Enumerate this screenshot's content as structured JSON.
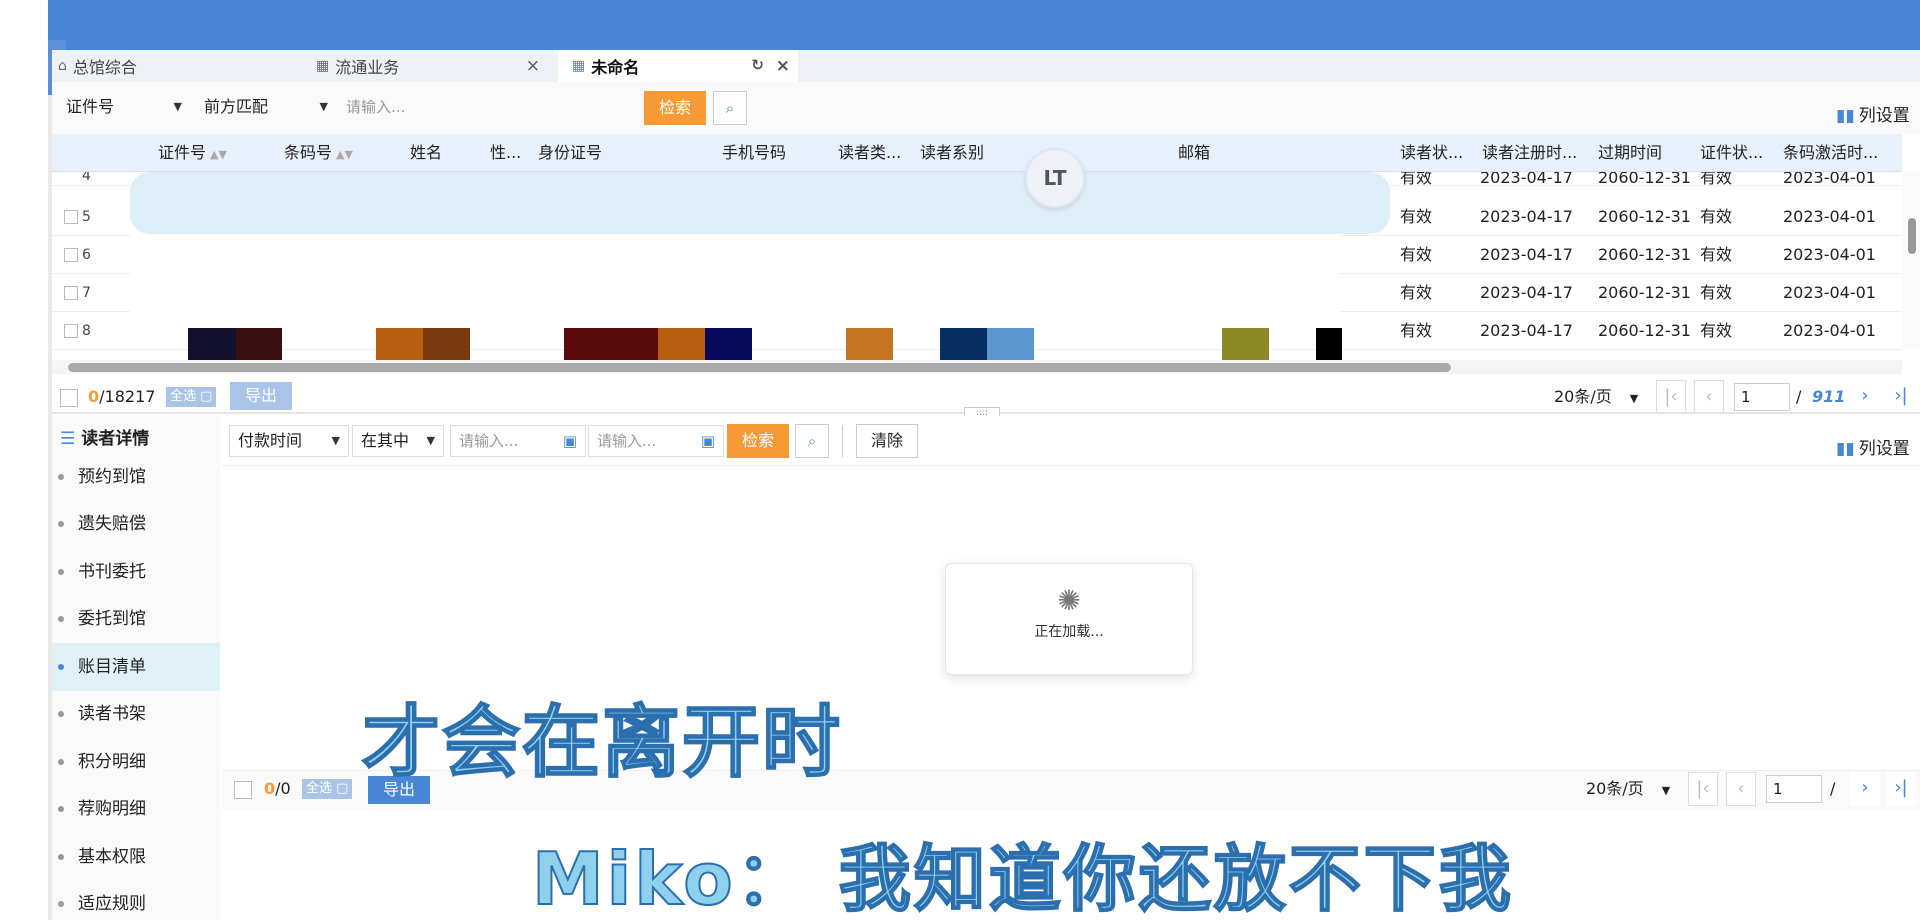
{
  "tabs": [
    {
      "label": "总馆综合",
      "icon": "home-icon"
    },
    {
      "label": "流通业务",
      "icon": "grid-icon"
    },
    {
      "label": "未命名",
      "icon": "grid-icon"
    }
  ],
  "toolbar1": {
    "field_select": "证件号",
    "match_select": "前方匹配",
    "search_placeholder": "请输入...",
    "search_label": "检索",
    "column_settings": "列设置"
  },
  "table": {
    "columns": [
      "证件号",
      "条码号",
      "姓名",
      "性...",
      "身份证号",
      "手机号码",
      "读者类...",
      "读者系别",
      "邮箱",
      "读者状...",
      "读者注册时...",
      "过期时间",
      "证件状...",
      "条码激活时..."
    ],
    "rows": [
      {
        "index": "4",
        "status": "有效",
        "reg": "2023-04-17",
        "expire": "2060-12-31",
        "cert": "有效",
        "activate": "2023-04-01"
      },
      {
        "index": "5",
        "status": "有效",
        "reg": "2023-04-17",
        "expire": "2060-12-31",
        "cert": "有效",
        "activate": "2023-04-01"
      },
      {
        "index": "6",
        "status": "有效",
        "reg": "2023-04-17",
        "expire": "2060-12-31",
        "cert": "有效",
        "activate": "2023-04-01"
      },
      {
        "index": "7",
        "status": "有效",
        "reg": "2023-04-17",
        "expire": "2060-12-31",
        "cert": "有效",
        "activate": "2023-04-01"
      },
      {
        "index": "8",
        "status": "有效",
        "reg": "2023-04-17",
        "expire": "2060-12-31",
        "cert": "有效",
        "activate": "2023-04-01"
      }
    ],
    "avatar_text": "LT"
  },
  "pager1": {
    "selected": "0",
    "total": "/18217",
    "select_all": "全选",
    "export": "导出",
    "page_size": "20条/页",
    "page": "1",
    "sep": "/",
    "total_pages": "911"
  },
  "sidebar": {
    "title": "读者详情",
    "items": [
      "预约到馆",
      "遗失赔偿",
      "书刊委托",
      "委托到馆",
      "账目清单",
      "读者书架",
      "积分明细",
      "荐购明细",
      "基本权限",
      "适应规则"
    ],
    "active_index": 4
  },
  "toolbar2": {
    "field_select": "付款时间",
    "range_select": "在其中",
    "start_placeholder": "请输入...",
    "end_placeholder": "请输入...",
    "search_label": "检索",
    "clear_label": "清除",
    "column_settings": "列设置"
  },
  "loading_text": "正在加载...",
  "pager2": {
    "selected": "0",
    "total": "/0",
    "select_all": "全选",
    "export": "导出",
    "page_size": "20条/页",
    "page": "1",
    "sep": "/"
  },
  "subtitles": {
    "line1": "才会在离开时",
    "line2": "Miko： 我知道你还放不下我"
  },
  "colors": {
    "accent_blue": "#4a86d6",
    "accent_orange": "#f79a35",
    "header_bg": "#e8f0fb",
    "active_side": "#e0f0f7"
  }
}
